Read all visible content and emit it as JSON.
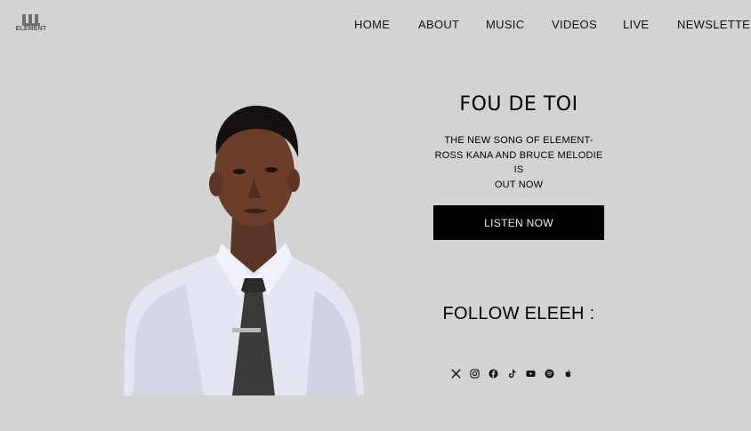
{
  "brand": {
    "logo_text": "ELEMENT"
  },
  "nav": {
    "items": [
      {
        "label": "HOME"
      },
      {
        "label": "ABOUT"
      },
      {
        "label": "MUSIC"
      },
      {
        "label": "VIDEOS"
      },
      {
        "label": "LIVE"
      },
      {
        "label": "NEWSLETTER"
      }
    ]
  },
  "hero": {
    "title": "FOU DE TOI",
    "subtitle_lines": [
      "THE NEW SONG OF ELEMENT-",
      "ROSS KANA AND BRUCE MELODIE",
      "IS",
      "OUT NOW"
    ],
    "cta_label": "LISTEN NOW",
    "follow_title": "FOLLOW ELEEH :"
  },
  "socials": [
    {
      "icon": "x-twitter-icon"
    },
    {
      "icon": "instagram-icon"
    },
    {
      "icon": "facebook-icon"
    },
    {
      "icon": "tiktok-icon"
    },
    {
      "icon": "youtube-icon"
    },
    {
      "icon": "spotify-icon"
    },
    {
      "icon": "apple-icon"
    }
  ],
  "colors": {
    "background": "#d3d3d3",
    "button_bg": "#000000",
    "button_text": "#f0f0f0",
    "text": "#000000"
  }
}
